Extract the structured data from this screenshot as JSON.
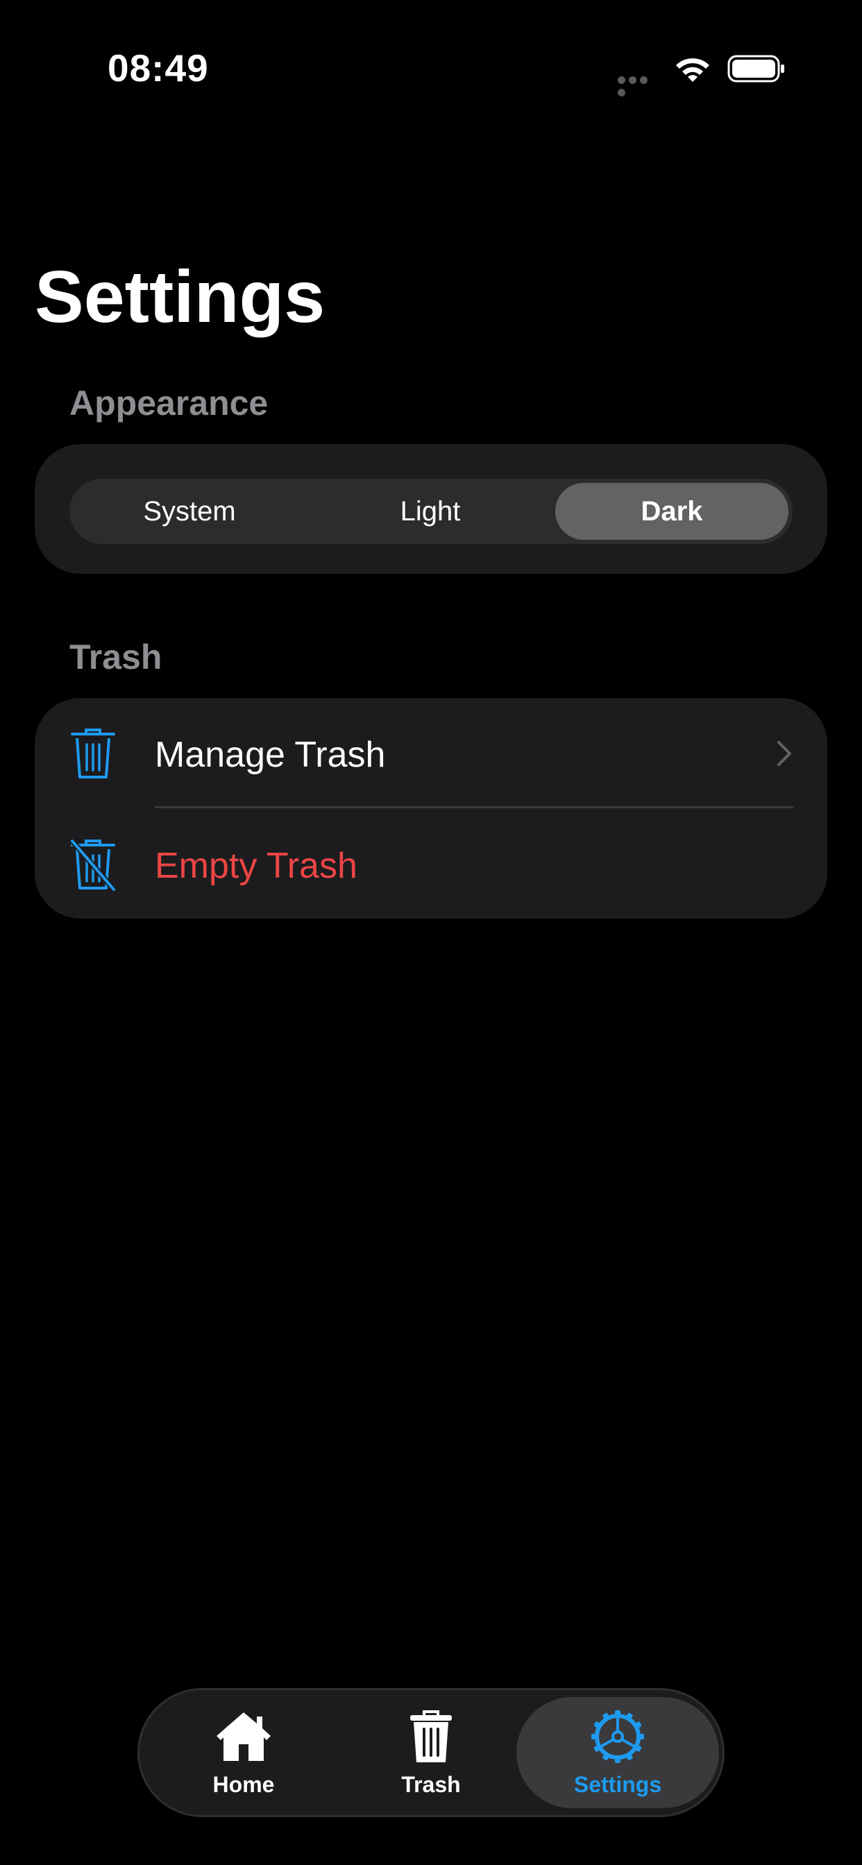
{
  "status_bar": {
    "time": "08:49"
  },
  "page": {
    "title": "Settings"
  },
  "appearance": {
    "section_label": "Appearance",
    "options": [
      "System",
      "Light",
      "Dark"
    ],
    "selected": "Dark"
  },
  "trash": {
    "section_label": "Trash",
    "rows": [
      {
        "label": "Manage Trash",
        "icon": "trash-icon"
      },
      {
        "label": "Empty Trash",
        "icon": "trash-slash-icon"
      }
    ]
  },
  "tab_bar": {
    "tabs": [
      {
        "label": "Home",
        "icon": "house-icon"
      },
      {
        "label": "Trash",
        "icon": "trash-icon"
      },
      {
        "label": "Settings",
        "icon": "gear-icon"
      }
    ],
    "active": "Settings"
  },
  "colors": {
    "background": "#000000",
    "card": "#1c1c1e",
    "accent_blue": "#1e9bf0",
    "destructive_red": "#ec4545",
    "secondary_label": "#8e8e93"
  }
}
